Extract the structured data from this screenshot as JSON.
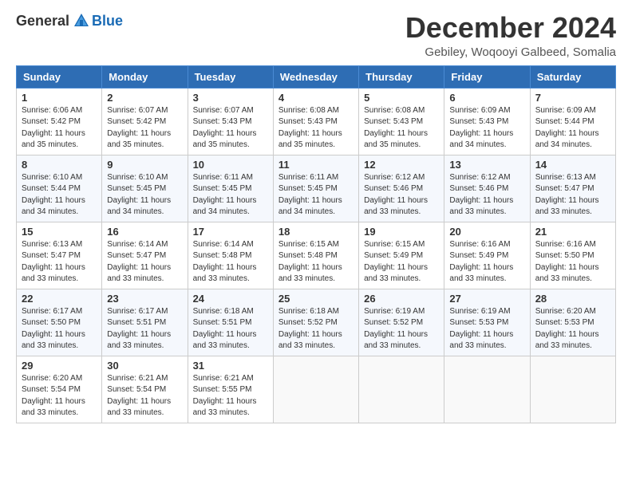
{
  "header": {
    "logo_general": "General",
    "logo_blue": "Blue",
    "title": "December 2024",
    "subtitle": "Gebiley, Woqooyi Galbeed, Somalia"
  },
  "weekdays": [
    "Sunday",
    "Monday",
    "Tuesday",
    "Wednesday",
    "Thursday",
    "Friday",
    "Saturday"
  ],
  "weeks": [
    [
      {
        "day": "1",
        "sunrise": "6:06 AM",
        "sunset": "5:42 PM",
        "daylight": "11 hours and 35 minutes."
      },
      {
        "day": "2",
        "sunrise": "6:07 AM",
        "sunset": "5:42 PM",
        "daylight": "11 hours and 35 minutes."
      },
      {
        "day": "3",
        "sunrise": "6:07 AM",
        "sunset": "5:43 PM",
        "daylight": "11 hours and 35 minutes."
      },
      {
        "day": "4",
        "sunrise": "6:08 AM",
        "sunset": "5:43 PM",
        "daylight": "11 hours and 35 minutes."
      },
      {
        "day": "5",
        "sunrise": "6:08 AM",
        "sunset": "5:43 PM",
        "daylight": "11 hours and 35 minutes."
      },
      {
        "day": "6",
        "sunrise": "6:09 AM",
        "sunset": "5:43 PM",
        "daylight": "11 hours and 34 minutes."
      },
      {
        "day": "7",
        "sunrise": "6:09 AM",
        "sunset": "5:44 PM",
        "daylight": "11 hours and 34 minutes."
      }
    ],
    [
      {
        "day": "8",
        "sunrise": "6:10 AM",
        "sunset": "5:44 PM",
        "daylight": "11 hours and 34 minutes."
      },
      {
        "day": "9",
        "sunrise": "6:10 AM",
        "sunset": "5:45 PM",
        "daylight": "11 hours and 34 minutes."
      },
      {
        "day": "10",
        "sunrise": "6:11 AM",
        "sunset": "5:45 PM",
        "daylight": "11 hours and 34 minutes."
      },
      {
        "day": "11",
        "sunrise": "6:11 AM",
        "sunset": "5:45 PM",
        "daylight": "11 hours and 34 minutes."
      },
      {
        "day": "12",
        "sunrise": "6:12 AM",
        "sunset": "5:46 PM",
        "daylight": "11 hours and 33 minutes."
      },
      {
        "day": "13",
        "sunrise": "6:12 AM",
        "sunset": "5:46 PM",
        "daylight": "11 hours and 33 minutes."
      },
      {
        "day": "14",
        "sunrise": "6:13 AM",
        "sunset": "5:47 PM",
        "daylight": "11 hours and 33 minutes."
      }
    ],
    [
      {
        "day": "15",
        "sunrise": "6:13 AM",
        "sunset": "5:47 PM",
        "daylight": "11 hours and 33 minutes."
      },
      {
        "day": "16",
        "sunrise": "6:14 AM",
        "sunset": "5:47 PM",
        "daylight": "11 hours and 33 minutes."
      },
      {
        "day": "17",
        "sunrise": "6:14 AM",
        "sunset": "5:48 PM",
        "daylight": "11 hours and 33 minutes."
      },
      {
        "day": "18",
        "sunrise": "6:15 AM",
        "sunset": "5:48 PM",
        "daylight": "11 hours and 33 minutes."
      },
      {
        "day": "19",
        "sunrise": "6:15 AM",
        "sunset": "5:49 PM",
        "daylight": "11 hours and 33 minutes."
      },
      {
        "day": "20",
        "sunrise": "6:16 AM",
        "sunset": "5:49 PM",
        "daylight": "11 hours and 33 minutes."
      },
      {
        "day": "21",
        "sunrise": "6:16 AM",
        "sunset": "5:50 PM",
        "daylight": "11 hours and 33 minutes."
      }
    ],
    [
      {
        "day": "22",
        "sunrise": "6:17 AM",
        "sunset": "5:50 PM",
        "daylight": "11 hours and 33 minutes."
      },
      {
        "day": "23",
        "sunrise": "6:17 AM",
        "sunset": "5:51 PM",
        "daylight": "11 hours and 33 minutes."
      },
      {
        "day": "24",
        "sunrise": "6:18 AM",
        "sunset": "5:51 PM",
        "daylight": "11 hours and 33 minutes."
      },
      {
        "day": "25",
        "sunrise": "6:18 AM",
        "sunset": "5:52 PM",
        "daylight": "11 hours and 33 minutes."
      },
      {
        "day": "26",
        "sunrise": "6:19 AM",
        "sunset": "5:52 PM",
        "daylight": "11 hours and 33 minutes."
      },
      {
        "day": "27",
        "sunrise": "6:19 AM",
        "sunset": "5:53 PM",
        "daylight": "11 hours and 33 minutes."
      },
      {
        "day": "28",
        "sunrise": "6:20 AM",
        "sunset": "5:53 PM",
        "daylight": "11 hours and 33 minutes."
      }
    ],
    [
      {
        "day": "29",
        "sunrise": "6:20 AM",
        "sunset": "5:54 PM",
        "daylight": "11 hours and 33 minutes."
      },
      {
        "day": "30",
        "sunrise": "6:21 AM",
        "sunset": "5:54 PM",
        "daylight": "11 hours and 33 minutes."
      },
      {
        "day": "31",
        "sunrise": "6:21 AM",
        "sunset": "5:55 PM",
        "daylight": "11 hours and 33 minutes."
      },
      null,
      null,
      null,
      null
    ]
  ]
}
